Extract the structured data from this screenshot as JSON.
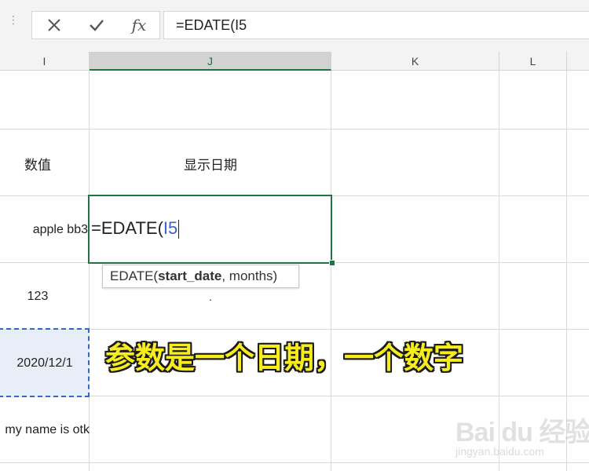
{
  "formula_bar": {
    "cancel_icon": "close-icon",
    "enter_icon": "checkmark-icon",
    "fx_label": "fx",
    "formula": "=EDATE(I5"
  },
  "columns": [
    "I",
    "J",
    "K",
    "L"
  ],
  "cells": {
    "I3": "数值",
    "J3": "显示日期",
    "I4": "apple bb3",
    "I5": "123",
    "J5": ".",
    "I6": "2020/12/1",
    "I7": "my name is otk"
  },
  "active_cell": {
    "prefix": "=EDATE(",
    "ref": "I5"
  },
  "tooltip": {
    "func": "EDATE(",
    "arg_bold": "start_date",
    "rest": ", months)"
  },
  "annotation": "参数是一个日期，一个数字",
  "watermark": {
    "logo": "Bai du 经验",
    "url": "jingyan.baidu.com"
  },
  "colors": {
    "accent": "#217346",
    "reference": "#3a63c8",
    "annotation": "#f6ec1e"
  }
}
